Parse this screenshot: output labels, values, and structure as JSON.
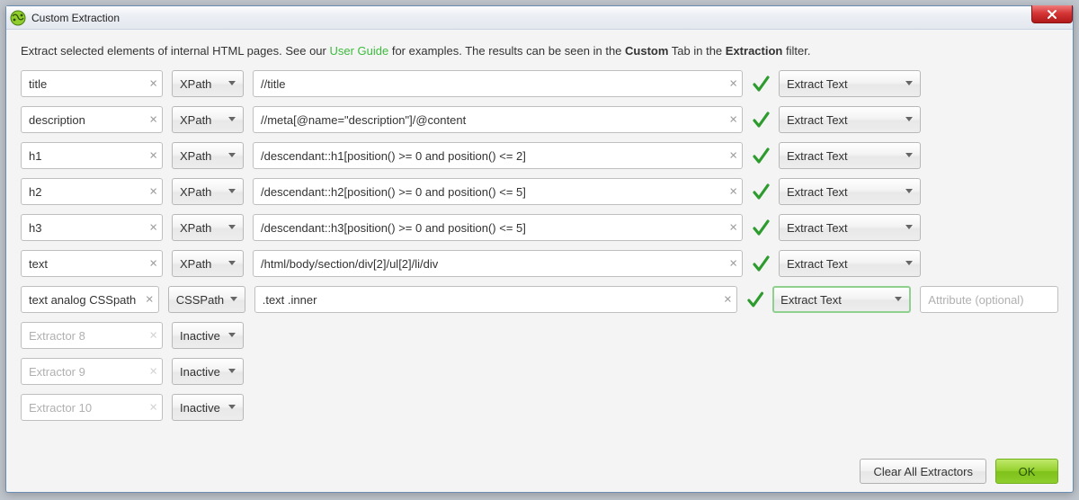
{
  "window": {
    "title": "Custom Extraction"
  },
  "intro": {
    "pre": "Extract selected elements of internal HTML pages. See our ",
    "link": "User Guide",
    "mid": " for examples. The results can be seen in the ",
    "bold1": "Custom",
    "mid2": " Tab in the ",
    "bold2": "Extraction",
    "post": " filter."
  },
  "extract_label": "Extract Text",
  "attr_placeholder": "Attribute (optional)",
  "type_opts": {
    "xpath": "XPath",
    "csspath": "CSSPath",
    "inactive": "Inactive"
  },
  "rows": [
    {
      "name": "title",
      "type": "xpath",
      "expr": "//title"
    },
    {
      "name": "description",
      "type": "xpath",
      "expr": "//meta[@name=\"description\"]/@content"
    },
    {
      "name": "h1",
      "type": "xpath",
      "expr": "/descendant::h1[position() >= 0 and position() <= 2]"
    },
    {
      "name": "h2",
      "type": "xpath",
      "expr": "/descendant::h2[position() >= 0 and position() <= 5]"
    },
    {
      "name": "h3",
      "type": "xpath",
      "expr": "/descendant::h3[position() >= 0 and position() <= 5]"
    },
    {
      "name": "text",
      "type": "xpath",
      "expr": "/html/body/section/div[2]/ul[2]/li/div"
    },
    {
      "name": "text analog CSSpath",
      "type": "csspath",
      "expr": ".text .inner",
      "highlight": true,
      "show_attr": true
    },
    {
      "name": "Extractor 8",
      "type": "inactive",
      "disabled": true
    },
    {
      "name": "Extractor 9",
      "type": "inactive",
      "disabled": true
    },
    {
      "name": "Extractor 10",
      "type": "inactive",
      "disabled": true
    }
  ],
  "buttons": {
    "clear_all": "Clear All Extractors",
    "ok": "OK"
  }
}
